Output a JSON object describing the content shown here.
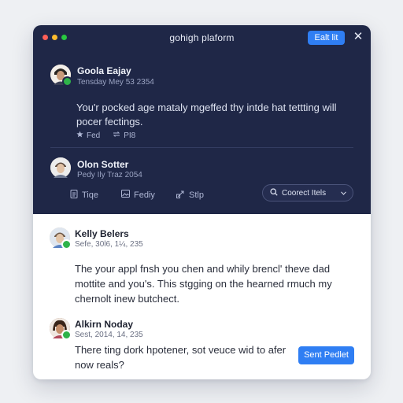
{
  "window": {
    "title": "gohigh plaform",
    "edit_label": "Ealt lit",
    "close_glyph": "✕"
  },
  "colors": {
    "dot_red": "#ff5f57",
    "dot_yellow": "#febc2e",
    "dot_green": "#28c840",
    "accent": "#2f7ef3",
    "status_online": "#2fb34a"
  },
  "posts": [
    {
      "author": "Goola Eajay",
      "timestamp": "Tensday Mey 53 2354",
      "body": "You'r pocked age mataly mgeffed thy intde hat tettting will pocer fectings.",
      "avatar_icon": "user-avatar",
      "reactions": [
        {
          "icon": "star-icon",
          "label": "Fed"
        },
        {
          "icon": "repost-icon",
          "label": "PI8"
        }
      ]
    },
    {
      "author": "Olon Sotter",
      "timestamp": "Pedy Ily Traz 2054",
      "avatar_icon": "user-avatar",
      "tools": [
        {
          "icon": "document-icon",
          "label": "Tiqe"
        },
        {
          "icon": "image-icon",
          "label": "Fediy"
        },
        {
          "icon": "link-icon",
          "label": "Stlp"
        }
      ],
      "search": {
        "label": "Coorect Itels",
        "icon": "search-icon"
      }
    }
  ],
  "comments": [
    {
      "author": "Kelly Belers",
      "timestamp": "Sefe, 30l6, 1¼, 235",
      "body": "The your appl fnsh you chen and whily brencl' theve dad mottite and you's. This stgging on the hearned rmuch my chernolt inew butchect."
    },
    {
      "author": "Alkirn Noday",
      "timestamp": "Sest, 2014, 14, 235",
      "body": "There ting dork hpotener, sot veuce wid to afer now reals?",
      "send_label": "Sent Pedlet"
    }
  ]
}
